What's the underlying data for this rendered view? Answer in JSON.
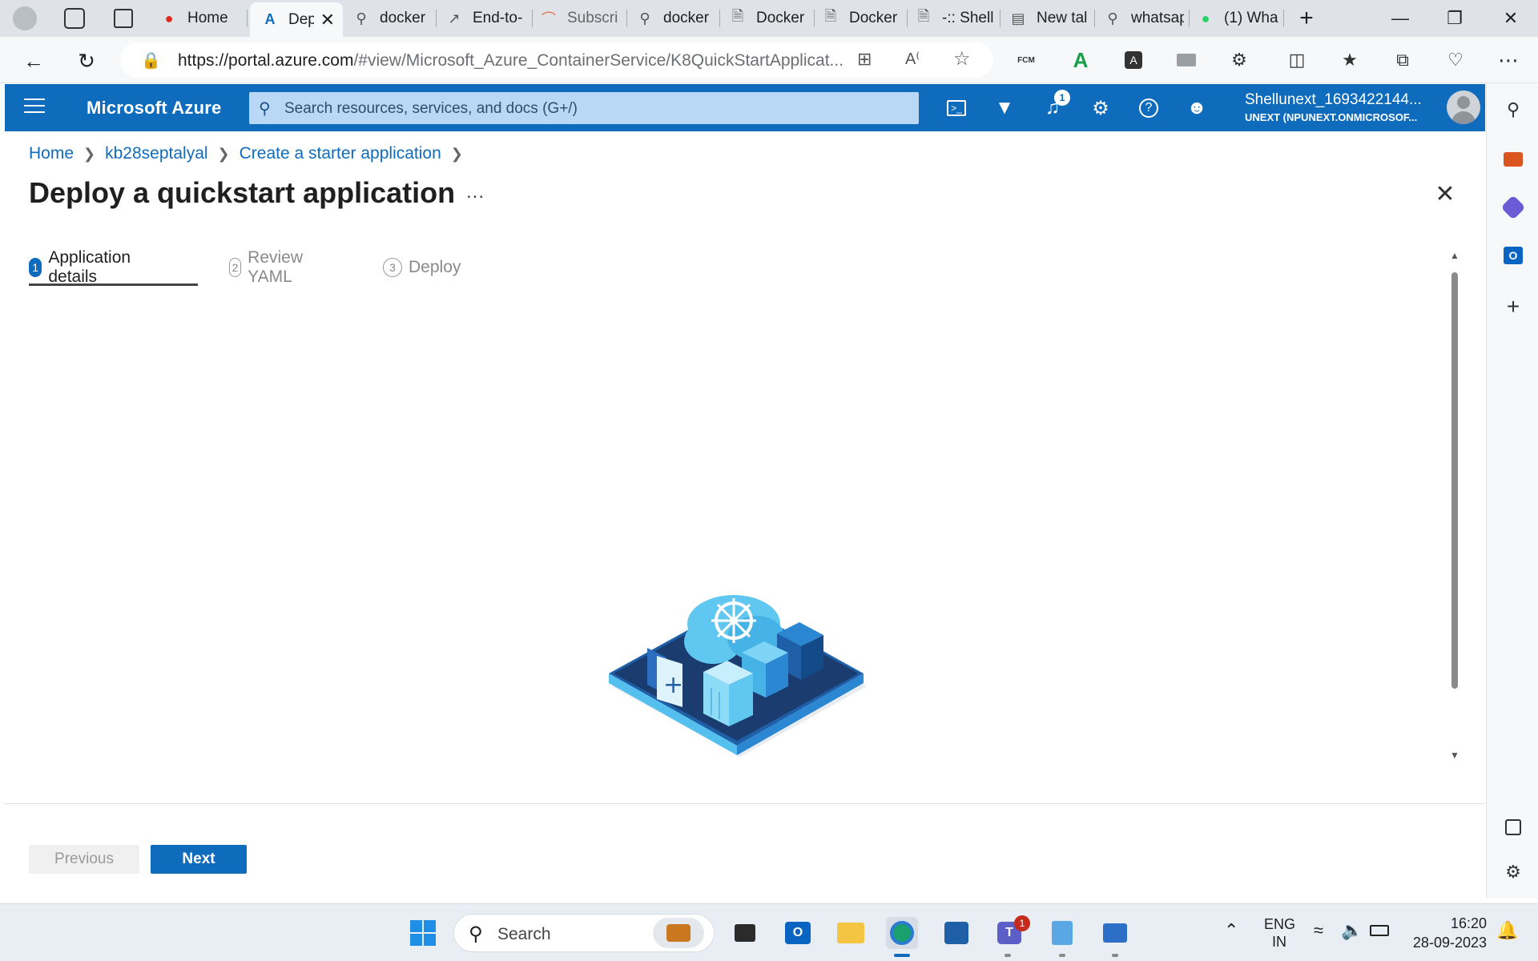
{
  "browser": {
    "tabs": [
      {
        "label": "Home",
        "icon": "shell-logo-icon"
      },
      {
        "label": "Dep",
        "icon": "azure-logo-icon",
        "active": true
      },
      {
        "label": "docker",
        "icon": "search-icon"
      },
      {
        "label": "End-to-",
        "icon": "chart-icon"
      },
      {
        "label": "Subscri",
        "icon": "loading-icon"
      },
      {
        "label": "docker",
        "icon": "search-icon"
      },
      {
        "label": "Docker",
        "icon": "page-icon"
      },
      {
        "label": "Docker",
        "icon": "page-icon"
      },
      {
        "label": "-:: Shell",
        "icon": "page-icon"
      },
      {
        "label": "New tal",
        "icon": "newtab-icon"
      },
      {
        "label": "whatsap",
        "icon": "search-icon"
      },
      {
        "label": "(1) Wha",
        "icon": "whatsapp-icon"
      }
    ],
    "url_host": "https://portal.azure.com",
    "url_path": "/#view/Microsoft_Azure_ContainerService/K8QuickStartApplicat..."
  },
  "azure": {
    "brand": "Microsoft Azure",
    "search_placeholder": "Search resources, services, and docs (G+/)",
    "notification_count": "1",
    "account_name": "Shellunext_1693422144...",
    "account_tenant": "UNEXT (NPUNEXT.ONMICROSOF..."
  },
  "page": {
    "breadcrumb": [
      "Home",
      "kb28septalyal",
      "Create a starter application"
    ],
    "title": "Deploy a quickstart application",
    "more": "...",
    "steps": [
      {
        "num": "1",
        "label": "Application details",
        "active": true
      },
      {
        "num": "2",
        "label": "Review YAML",
        "active": false
      },
      {
        "num": "3",
        "label": "Deploy",
        "active": false
      }
    ],
    "buttons": {
      "previous": "Previous",
      "next": "Next"
    }
  },
  "taskbar": {
    "search_label": "Search",
    "teams_badge": "1",
    "lang_line1": "ENG",
    "lang_line2": "IN",
    "time": "16:20",
    "date": "28-09-2023"
  },
  "colors": {
    "azure_blue": "#0f6cbd",
    "search_bg": "#b9d8f5"
  }
}
